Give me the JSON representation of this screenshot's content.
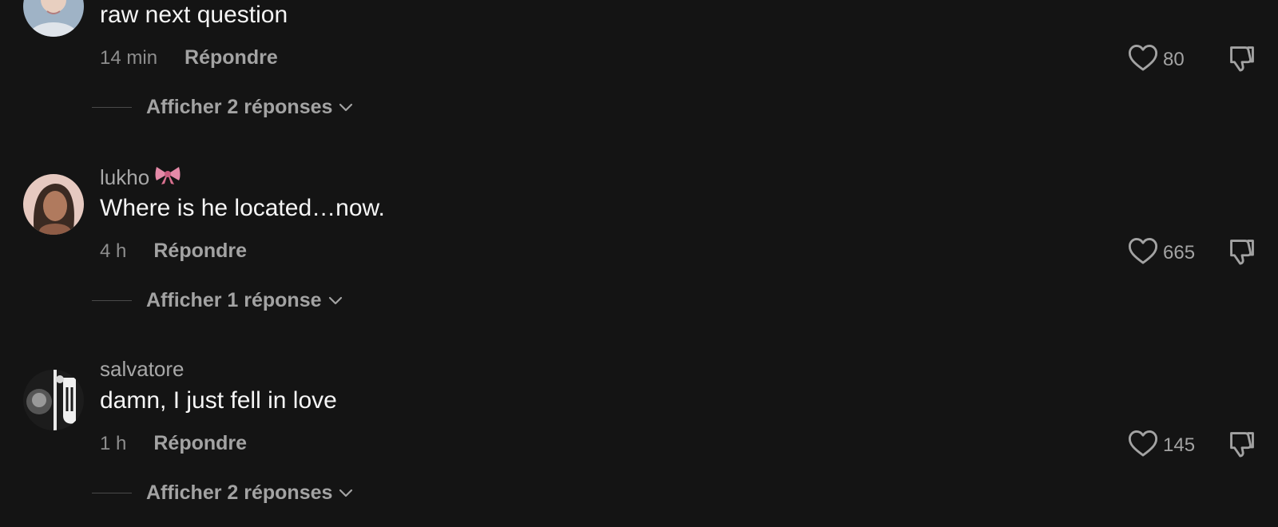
{
  "comments": [
    {
      "username": "",
      "text": "raw next question",
      "time": "14 min",
      "reply_label": "Répondre",
      "likes": "80",
      "replies_label": "Afficher 2 réponses",
      "avatar_color": "#b9c4cf"
    },
    {
      "username": "lukho",
      "username_emoji": "🎀",
      "text": "Where is he located…now.",
      "time": "4 h",
      "reply_label": "Répondre",
      "likes": "665",
      "replies_label": "Afficher 1 réponse",
      "avatar_color": "#c9a08c"
    },
    {
      "username": "salvatore",
      "text": "damn, I just fell in love",
      "time": "1 h",
      "reply_label": "Répondre",
      "likes": "145",
      "replies_label": "Afficher 2 réponses",
      "avatar_color": "#2a2a2a"
    }
  ],
  "icons": {
    "like": "heart-outline-icon",
    "dislike": "thumbs-down-icon",
    "expand": "chevron-down-icon"
  },
  "colors": {
    "background": "#141414",
    "primary_text": "#f5f5f5",
    "secondary_text": "#a3a3a3"
  }
}
